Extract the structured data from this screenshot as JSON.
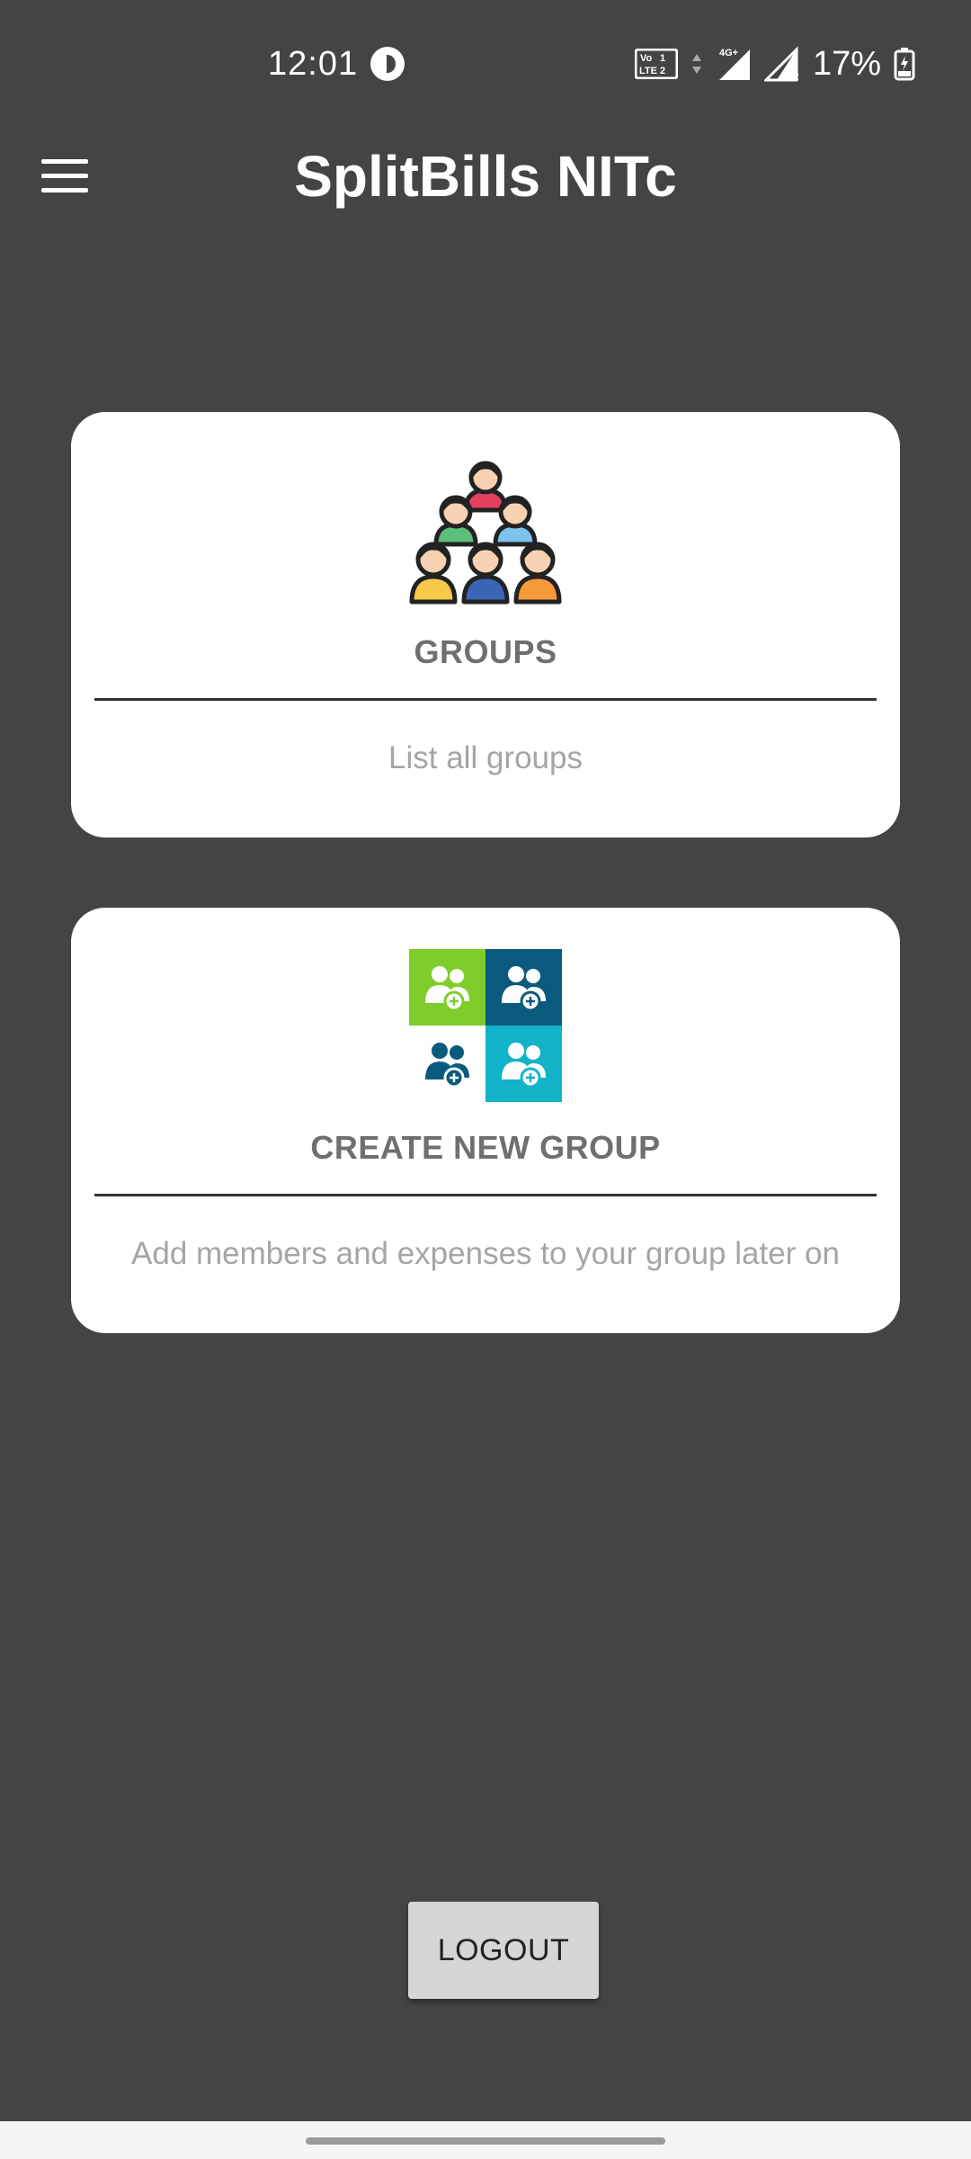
{
  "status_bar": {
    "time": "12:01",
    "battery_percent": "17%",
    "icons": [
      "app-notification-icon",
      "volte-icon",
      "data-arrows-icon",
      "signal-icon",
      "roaming-signal-icon",
      "battery-charging-icon"
    ]
  },
  "app_bar": {
    "title": "SplitBills NITc",
    "menu_icon": "hamburger-menu-icon"
  },
  "cards": {
    "groups": {
      "icon": "people-pyramid-icon",
      "title": "GROUPS",
      "subtitle": "List all groups"
    },
    "create": {
      "icon": "add-group-grid-icon",
      "title": "CREATE NEW GROUP",
      "subtitle": "Add members and expenses to your group later on"
    }
  },
  "logout": {
    "label": "LOGOUT"
  },
  "colors": {
    "background": "#444444",
    "card": "#ffffff",
    "card_title": "#6f6f6f",
    "card_subtitle": "#a5a5a5",
    "button": "#d6d6d6",
    "tile_green": "#7fcc2a",
    "tile_navy": "#0a5a7d",
    "tile_teal": "#12b3c9"
  }
}
